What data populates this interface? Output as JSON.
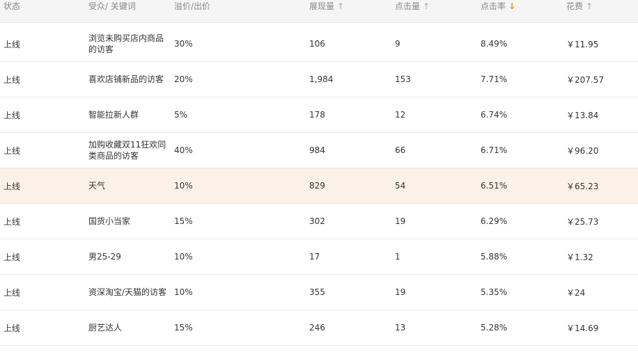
{
  "header": {
    "status": "状态",
    "keyword": "受众/ 关键词",
    "bid": "溢价/出价",
    "impressions": "展现量",
    "clicks": "点击量",
    "ctr": "点击率",
    "cost": "花费",
    "sort_icons": {
      "impressions": "arrow-up",
      "clicks": "arrow-up",
      "ctr": "arrow-down-active",
      "cost": "arrow-up"
    },
    "colors": {
      "active_sort": "#ff8a00",
      "header_bg": "#f5f5f5",
      "highlight_row": "#fbf1e8"
    }
  },
  "rows": [
    {
      "status": "上线",
      "keyword": "浏览未购买店内商品的访客",
      "bid": "30%",
      "impressions": "106",
      "clicks": "9",
      "ctr": "8.49%",
      "cost": "￥11.95"
    },
    {
      "status": "上线",
      "keyword": "喜欢店铺新品的访客",
      "bid": "20%",
      "impressions": "1,984",
      "clicks": "153",
      "ctr": "7.71%",
      "cost": "￥207.57"
    },
    {
      "status": "上线",
      "keyword": "智能拉新人群",
      "bid": "5%",
      "impressions": "178",
      "clicks": "12",
      "ctr": "6.74%",
      "cost": "￥13.84"
    },
    {
      "status": "上线",
      "keyword": "加购收藏双11狂欢同类商品的访客",
      "bid": "40%",
      "impressions": "984",
      "clicks": "66",
      "ctr": "6.71%",
      "cost": "￥96.20"
    },
    {
      "status": "上线",
      "keyword": "天气",
      "bid": "10%",
      "impressions": "829",
      "clicks": "54",
      "ctr": "6.51%",
      "cost": "￥65.23"
    },
    {
      "status": "上线",
      "keyword": "国货小当家",
      "bid": "15%",
      "impressions": "302",
      "clicks": "19",
      "ctr": "6.29%",
      "cost": "￥25.73"
    },
    {
      "status": "上线",
      "keyword": "男25-29",
      "bid": "10%",
      "impressions": "17",
      "clicks": "1",
      "ctr": "5.88%",
      "cost": "￥1.32"
    },
    {
      "status": "上线",
      "keyword": "资深淘宝/天猫的访客",
      "bid": "10%",
      "impressions": "355",
      "clicks": "19",
      "ctr": "5.35%",
      "cost": "￥24"
    },
    {
      "status": "上线",
      "keyword": "厨艺达人",
      "bid": "15%",
      "impressions": "246",
      "clicks": "13",
      "ctr": "5.28%",
      "cost": "￥14.69"
    }
  ],
  "highlighted_row_index": 4
}
